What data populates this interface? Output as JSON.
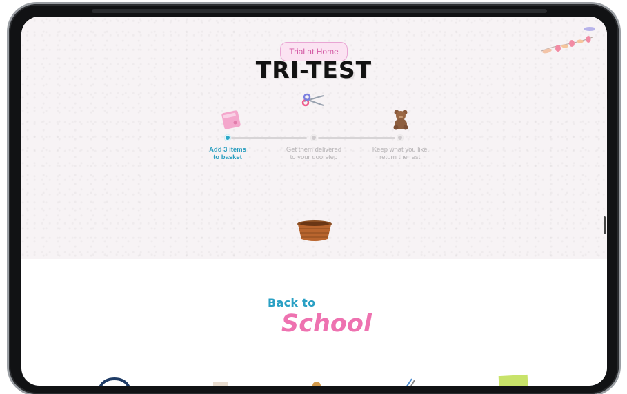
{
  "hero": {
    "badge": "Trial at Home",
    "title": "TRI-TEST"
  },
  "steps": [
    {
      "line1": "Add 3 items",
      "line2": "to basket",
      "active": true
    },
    {
      "line1": "Get them delivered",
      "line2": "to your doorstep",
      "active": false
    },
    {
      "line1": "Keep what you like,",
      "line2": "return the rest.",
      "active": false
    }
  ],
  "section": {
    "small_title": "Back to",
    "big_title": "School"
  },
  "icons": {
    "scissors": "scissors-icon",
    "garland": "garland-icon",
    "book": "book-icon",
    "teddy": "teddy-bear-icon",
    "basket": "basket-icon"
  },
  "colors": {
    "accent_blue": "#2aa7c7",
    "accent_pink": "#ee72b0",
    "badge_bg": "#fbe3f2"
  }
}
